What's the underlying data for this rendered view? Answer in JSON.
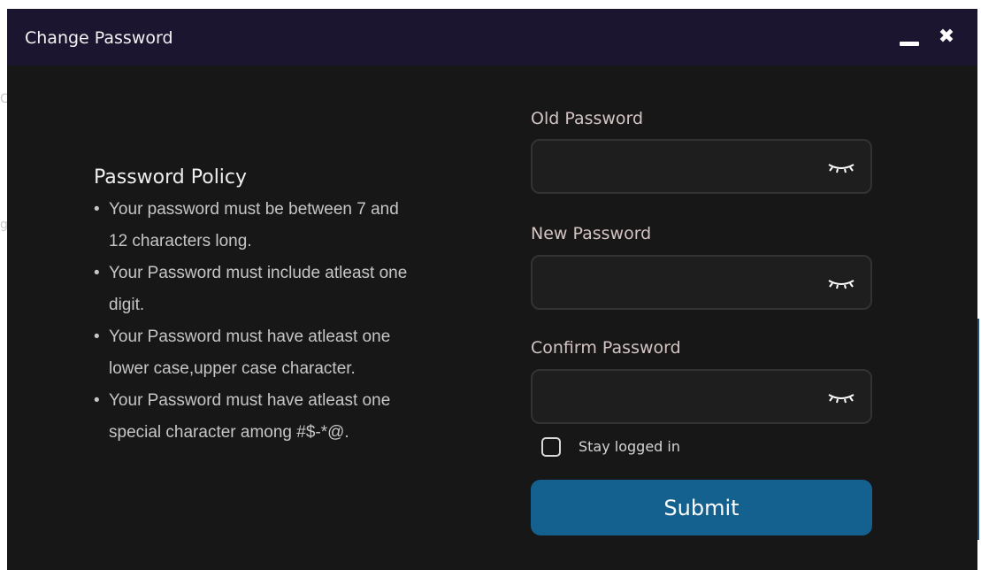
{
  "window": {
    "title": "Change Password",
    "minimize_icon": "minimize-icon",
    "close_icon": "close-icon",
    "titlebar_color": "#1c1530",
    "background_color": "#171717"
  },
  "background_fragments": [
    "C",
    "",
    "g"
  ],
  "policy": {
    "title": "Password Policy",
    "rules": [
      [
        "Your password must be between 7 and",
        "12 characters long."
      ],
      [
        "Your Password must include atleast one",
        "digit."
      ],
      [
        "Your Password must have atleast one",
        "lower case,upper case character."
      ],
      [
        "Your Password must have atleast one",
        "special character among #$-*@."
      ]
    ]
  },
  "form": {
    "old_password": {
      "label": "Old Password",
      "value": "",
      "icon": "eye-closed-icon"
    },
    "new_password": {
      "label": "New Password",
      "value": "",
      "icon": "eye-closed-icon"
    },
    "confirm_password": {
      "label": "Confirm Password",
      "value": "",
      "icon": "eye-closed-icon"
    },
    "stay_logged_in": {
      "label": "Stay logged in",
      "checked": false
    },
    "submit_label": "Submit",
    "accent_color": "#14608f"
  }
}
